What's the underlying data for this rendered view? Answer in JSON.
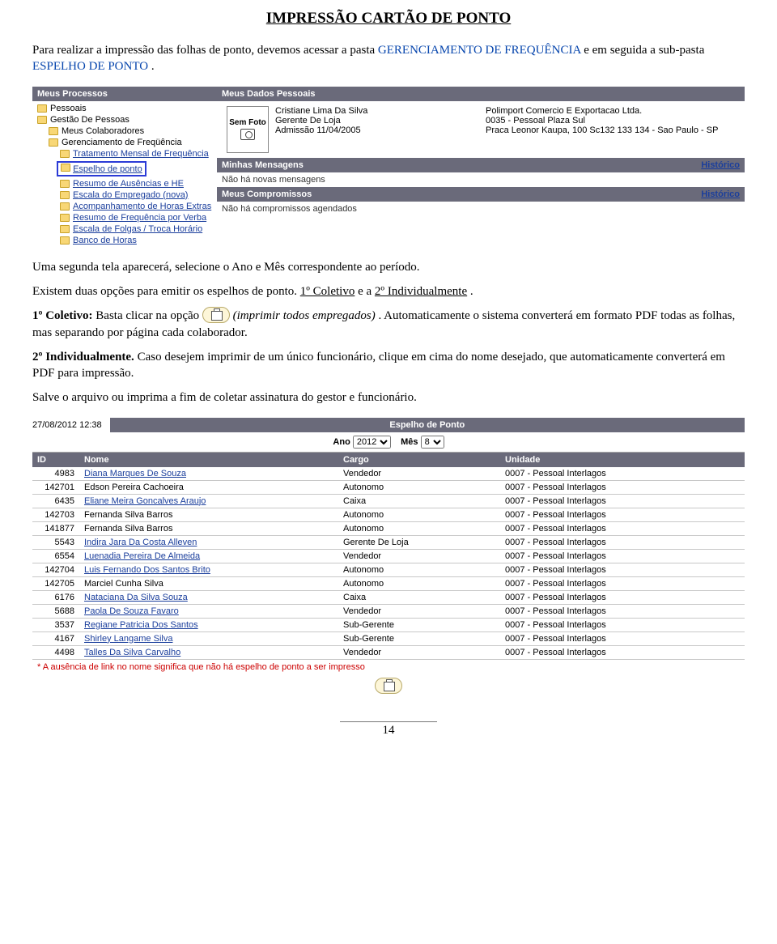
{
  "doc": {
    "title": "IMPRESSÃO CARTÃO DE PONTO",
    "p1_a": "Para realizar a impressão das folhas de ponto, devemos acessar a pasta ",
    "p1_link1": "GERENCIAMENTO DE FREQUÊNCIA",
    "p1_b": " e em seguida a sub-pasta ",
    "p1_link2": "ESPELHO DE PONTO",
    "p1_c": ".",
    "p2": "Uma segunda tela aparecerá, selecione o Ano e Mês correspondente ao período.",
    "p3_a": "Existem duas opções para emitir os espelhos de ponto. ",
    "p3_b": "1º Coletivo",
    "p3_c": " e a ",
    "p3_d": "2º Individualmente",
    "p3_e": ".",
    "p4_a": "1º Coletivo:",
    "p4_b": " Basta clicar na opção ",
    "p4_c": " (imprimir todos empregados)",
    "p4_d": ". Automaticamente o sistema converterá em formato PDF todas as folhas, mas separando por página cada colaborador.",
    "p5_a": "2º Individualmente.",
    "p5_b": " Caso desejem imprimir de um único funcionário, clique em cima do nome desejado, que automaticamente converterá em PDF para impressão.",
    "p6": "Salve o arquivo ou imprima a fim de coletar assinatura do gestor e funcionário.",
    "page_num": "14"
  },
  "ss1": {
    "left_header": "Meus Processos",
    "right_header1": "Meus Dados Pessoais",
    "right_header2": "Minhas Mensagens",
    "right_header3": "Meus Compromissos",
    "historico": "Histórico",
    "no_msg": "Não há novas mensagens",
    "no_comp": "Não há compromissos agendados",
    "tree": [
      {
        "label": "Pessoais",
        "indent": 0,
        "link": false
      },
      {
        "label": "Gestão De Pessoas",
        "indent": 0,
        "link": false
      },
      {
        "label": "Meus Colaboradores",
        "indent": 1,
        "link": false
      },
      {
        "label": "Gerenciamento de Freqüência",
        "indent": 1,
        "link": false
      },
      {
        "label": "Tratamento Mensal de Frequência",
        "indent": 2,
        "link": true
      },
      {
        "label": "Espelho de ponto",
        "indent": 2,
        "link": true,
        "hi": true
      },
      {
        "label": "Resumo de Ausências e HE",
        "indent": 2,
        "link": true
      },
      {
        "label": "Escala do Empregado (nova)",
        "indent": 2,
        "link": true
      },
      {
        "label": "Acompanhamento de Horas Extras",
        "indent": 2,
        "link": true
      },
      {
        "label": "Resumo de Frequência por Verba",
        "indent": 2,
        "link": true
      },
      {
        "label": "Escala de Folgas / Troca Horário",
        "indent": 2,
        "link": true
      },
      {
        "label": "Banco de Horas",
        "indent": 2,
        "link": true
      }
    ],
    "photo_label": "Sem Foto",
    "person": {
      "name": "Cristiane Lima Da Silva",
      "role": "Gerente De Loja",
      "adm": "Admissão 11/04/2005"
    },
    "company": {
      "name": "Polimport Comercio E Exportacao Ltda.",
      "unit": "0035 - Pessoal Plaza Sul",
      "addr": "Praca Leonor Kaupa, 100 Sc132 133 134 - Sao Paulo - SP"
    }
  },
  "ss2": {
    "date": "27/08/2012 12:38",
    "title": "Espelho de Ponto",
    "ano_label": "Ano",
    "mes_label": "Mês",
    "ano_val": "2012",
    "mes_val": "8",
    "cols": {
      "id": "ID",
      "nome": "Nome",
      "cargo": "Cargo",
      "unidade": "Unidade"
    },
    "rows": [
      {
        "id": "4983",
        "nome": "Diana Marques De Souza",
        "link": true,
        "cargo": "Vendedor",
        "unidade": "0007 - Pessoal Interlagos"
      },
      {
        "id": "142701",
        "nome": "Edson Pereira Cachoeira",
        "link": false,
        "cargo": "Autonomo",
        "unidade": "0007 - Pessoal Interlagos"
      },
      {
        "id": "6435",
        "nome": "Eliane Meira Goncalves Araujo",
        "link": true,
        "cargo": "Caixa",
        "unidade": "0007 - Pessoal Interlagos"
      },
      {
        "id": "142703",
        "nome": "Fernanda Silva Barros",
        "link": false,
        "cargo": "Autonomo",
        "unidade": "0007 - Pessoal Interlagos"
      },
      {
        "id": "141877",
        "nome": "Fernanda Silva Barros",
        "link": false,
        "cargo": "Autonomo",
        "unidade": "0007 - Pessoal Interlagos"
      },
      {
        "id": "5543",
        "nome": "Indira Jara Da Costa Alleven",
        "link": true,
        "cargo": "Gerente De Loja",
        "unidade": "0007 - Pessoal Interlagos"
      },
      {
        "id": "6554",
        "nome": "Luenadia Pereira De Almeida",
        "link": true,
        "cargo": "Vendedor",
        "unidade": "0007 - Pessoal Interlagos"
      },
      {
        "id": "142704",
        "nome": "Luis Fernando Dos Santos Brito",
        "link": true,
        "cargo": "Autonomo",
        "unidade": "0007 - Pessoal Interlagos"
      },
      {
        "id": "142705",
        "nome": "Marciel Cunha Silva",
        "link": false,
        "cargo": "Autonomo",
        "unidade": "0007 - Pessoal Interlagos"
      },
      {
        "id": "6176",
        "nome": "Nataciana Da Silva Souza",
        "link": true,
        "cargo": "Caixa",
        "unidade": "0007 - Pessoal Interlagos"
      },
      {
        "id": "5688",
        "nome": "Paola De Souza Favaro",
        "link": true,
        "cargo": "Vendedor",
        "unidade": "0007 - Pessoal Interlagos"
      },
      {
        "id": "3537",
        "nome": "Regiane Patricia Dos Santos",
        "link": true,
        "cargo": "Sub-Gerente",
        "unidade": "0007 - Pessoal Interlagos"
      },
      {
        "id": "4167",
        "nome": "Shirley Langame Silva",
        "link": true,
        "cargo": "Sub-Gerente",
        "unidade": "0007 - Pessoal Interlagos"
      },
      {
        "id": "4498",
        "nome": "Talles Da Silva Carvalho",
        "link": true,
        "cargo": "Vendedor",
        "unidade": "0007 - Pessoal Interlagos"
      }
    ],
    "footnote": "* A ausência de link no nome significa que não há espelho de ponto a ser impresso"
  }
}
